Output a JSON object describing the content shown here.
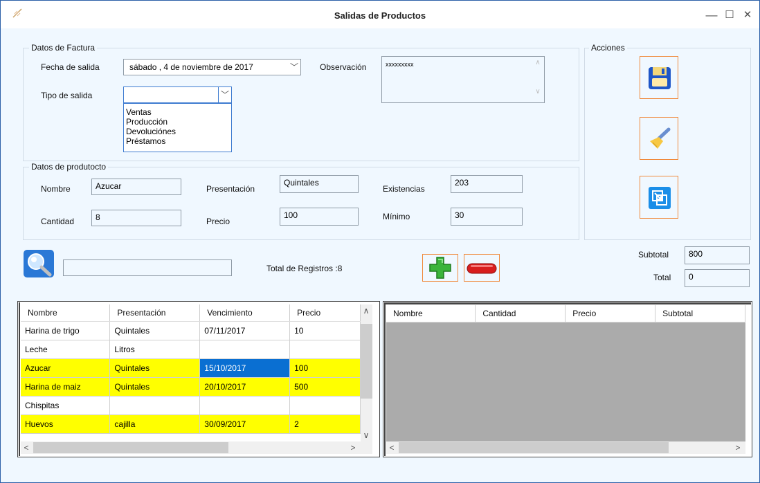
{
  "window": {
    "title": "Salidas de Productos",
    "minimize": "—",
    "maximize": "☐",
    "close": "✕"
  },
  "factura": {
    "legend": "Datos  de Factura",
    "fecha_label": "Fecha de salida",
    "fecha_value": "sábado ,  4 de noviembre de 2017",
    "observacion_label": "Observación",
    "observacion_value": "xxxxxxxxx",
    "tipo_label": "Tipo de salida",
    "tipo_value": "",
    "tipo_options": [
      "Ventas",
      "Producción",
      "Devoluciónes",
      "Préstamos"
    ]
  },
  "producto": {
    "legend": "Datos de produtocto",
    "nombre_label": "Nombre",
    "nombre_value": "Azucar",
    "cantidad_label": "Cantidad",
    "cantidad_value": "8",
    "presentacion_label": "Presentación",
    "presentacion_value": "Quintales",
    "precio_label": "Precio",
    "precio_value": "100",
    "existencias_label": "Existencias",
    "existencias_value": "203",
    "minimo_label": "Mínimo",
    "minimo_value": "30"
  },
  "acciones": {
    "legend": "Acciones",
    "buttons": [
      "save-icon",
      "broom-icon",
      "exit-icon"
    ]
  },
  "search": {
    "value": "",
    "total_registros": "Total de Registros :8"
  },
  "totals": {
    "subtotal_label": "Subtotal",
    "subtotal_value": "800",
    "total_label": "Total",
    "total_value": "0"
  },
  "left_grid": {
    "columns": [
      "Nombre",
      "Presentación",
      "Vencimiento",
      "Precio"
    ],
    "rows": [
      {
        "cells": [
          "Harina de trigo",
          "Quintales",
          "07/11/2017",
          "10"
        ],
        "highlight": false
      },
      {
        "cells": [
          "Leche",
          "Litros",
          "",
          ""
        ],
        "highlight": false
      },
      {
        "cells": [
          "Azucar",
          "Quintales",
          "15/10/2017",
          "100"
        ],
        "highlight": true
      },
      {
        "cells": [
          "Harina de maiz",
          "Quintales",
          "20/10/2017",
          "500"
        ],
        "highlight": true
      },
      {
        "cells": [
          "Chispitas",
          "",
          "",
          ""
        ],
        "highlight": false
      },
      {
        "cells": [
          "Huevos",
          "cajilla",
          "30/09/2017",
          "2"
        ],
        "highlight": true
      }
    ]
  },
  "right_grid": {
    "columns": [
      "Nombre",
      "Cantidad",
      "Precio",
      "Subtotal"
    ]
  },
  "colors": {
    "highlight": "#ffff00",
    "selected": "#0a6fd2",
    "action_border": "#f08a3c",
    "background": "#f0f8ff"
  }
}
